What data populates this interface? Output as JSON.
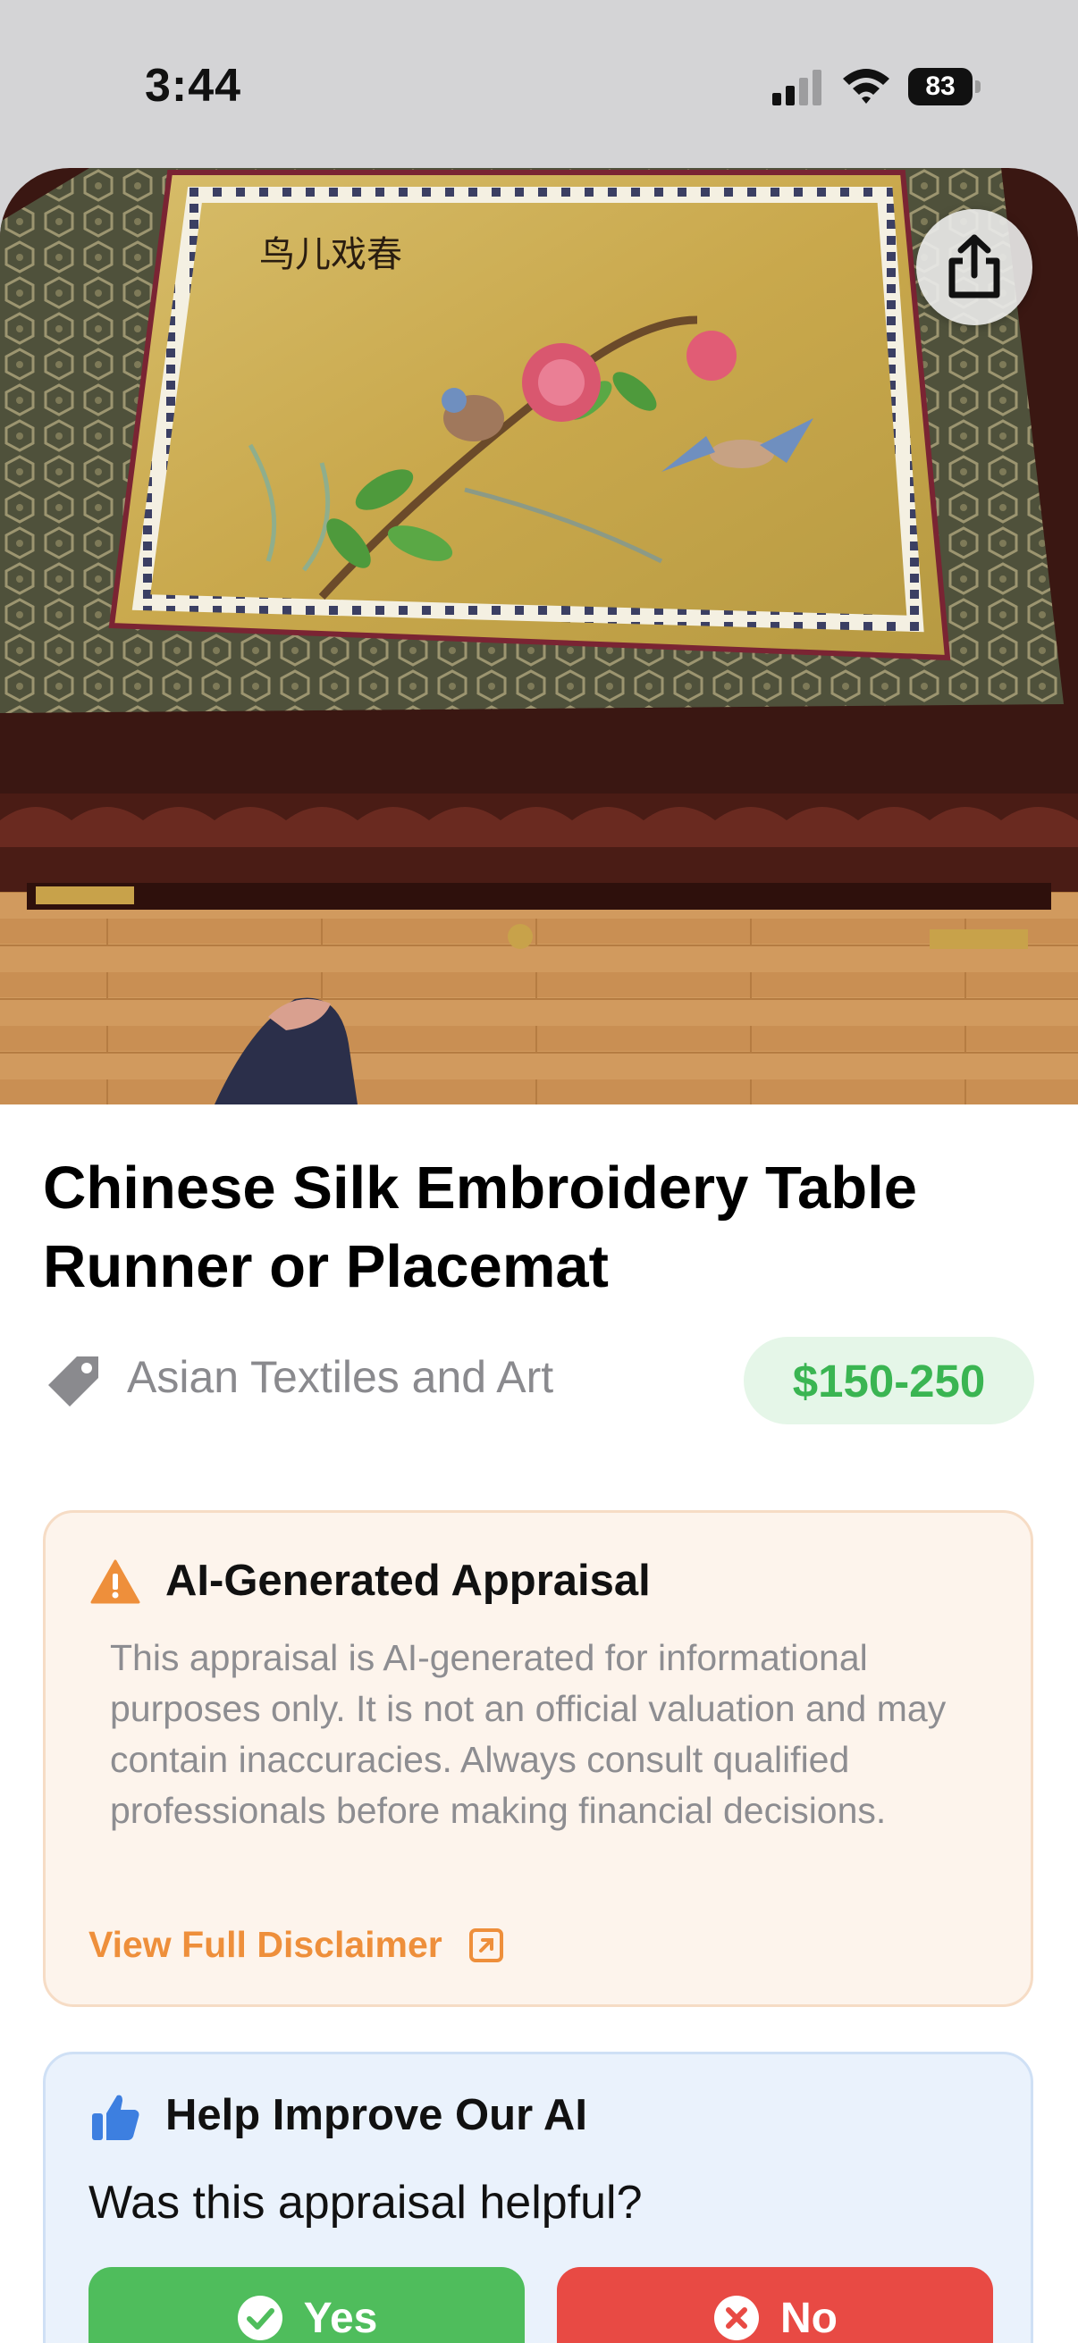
{
  "status_bar": {
    "time": "3:44",
    "battery_level": "83",
    "icons": [
      "signal-icon",
      "wifi-icon",
      "battery-icon"
    ]
  },
  "hero": {
    "share_icon": "share-icon",
    "embroidery_script": "鸟儿戏春"
  },
  "item": {
    "title": "Chinese Silk Embroidery Table Runner or Placemat",
    "category": "Asian Textiles and Art",
    "category_icon": "tag-icon",
    "price_range": "$150-250"
  },
  "disclaimer": {
    "icon": "warning-icon",
    "heading": "AI-Generated Appraisal",
    "body": "This appraisal is AI-generated for informational purposes only. It is not an official valuation and may contain inaccuracies. Always consult qualified professionals before making financial decisions.",
    "link_label": "View Full Disclaimer",
    "link_icon": "external-link-icon"
  },
  "feedback": {
    "icon": "thumbs-up-icon",
    "heading": "Help Improve Our AI",
    "question": "Was this appraisal helpful?",
    "yes_label": "Yes",
    "no_label": "No"
  },
  "colors": {
    "price_text": "#3ab552",
    "price_bg": "#e5f6e8",
    "warning_accent": "#ee8f3b",
    "disclaimer_bg": "#fdf4ec",
    "feedback_bg": "#eaf2fc",
    "yes_button": "#4fbd5c",
    "no_button": "#e84a44"
  }
}
